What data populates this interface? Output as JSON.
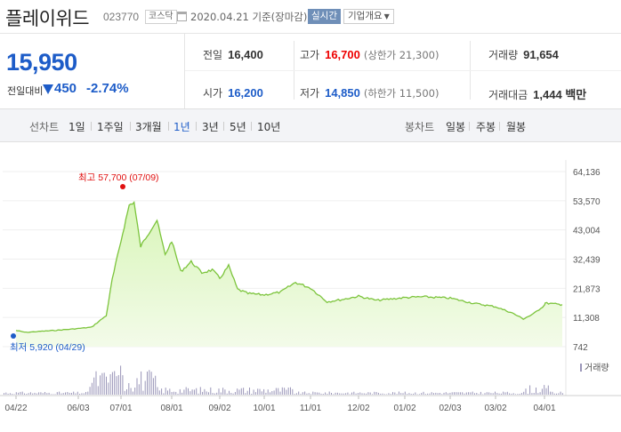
{
  "header": {
    "title": "플레이위드",
    "code": "023770",
    "market": "코스닥",
    "date_text": "2020.04.21 기준(장마감)",
    "realtime_label": "실시간",
    "company_info_label": "기업개요"
  },
  "summary": {
    "price": "15,950",
    "change_label": "전일대비",
    "change_value": "450",
    "change_pct": "-2.74%"
  },
  "stats": {
    "prev_label": "전일",
    "prev_value": "16,400",
    "high_label": "고가",
    "high_value": "16,700",
    "high_limit": "(상한가 21,300)",
    "volume_label": "거래량",
    "volume_value": "91,654",
    "open_label": "시가",
    "open_value": "16,200",
    "low_label": "저가",
    "low_value": "14,850",
    "low_limit": "(하한가 11,500)",
    "amount_label": "거래대금",
    "amount_value": "1,444 백만"
  },
  "periods": {
    "line_label": "선차트",
    "items": [
      "1일",
      "1주일",
      "3개월",
      "1년",
      "3년",
      "5년",
      "10년"
    ],
    "selected": "1년",
    "candle_label": "봉차트",
    "candle_items": [
      "일봉",
      "주봉",
      "월봉"
    ]
  },
  "chart_data": {
    "type": "area",
    "y_ticks": [
      "64,136",
      "53,570",
      "43,004",
      "32,439",
      "21,873",
      "11,308",
      "742"
    ],
    "ylim": [
      742,
      64136
    ],
    "x_ticks": [
      "04/22",
      "06/03",
      "07/01",
      "08/01",
      "09/02",
      "10/01",
      "11/01",
      "12/02",
      "01/02",
      "02/03",
      "03/02",
      "04/01"
    ],
    "high_annotation": "최고 57,700 (07/09)",
    "low_annotation": "최저 5,920 (04/29)",
    "volume_label": "거래량",
    "colors": {
      "line": "#7cc43c",
      "fill_top": "#d8f5b8",
      "fill_bottom": "#f3fbe9",
      "high": "#e01010",
      "low": "#1d5cc8",
      "volume": "#9a96b8"
    },
    "series": [
      {
        "date": "04/22",
        "value": 6600
      },
      {
        "date": "04/29",
        "value": 5920
      },
      {
        "date": "05/08",
        "value": 6300
      },
      {
        "date": "05/20",
        "value": 6700
      },
      {
        "date": "06/03",
        "value": 7300
      },
      {
        "date": "06/12",
        "value": 7800
      },
      {
        "date": "06/22",
        "value": 12000
      },
      {
        "date": "06/26",
        "value": 25000
      },
      {
        "date": "07/01",
        "value": 39000
      },
      {
        "date": "07/06",
        "value": 52000
      },
      {
        "date": "07/09",
        "value": 53000
      },
      {
        "date": "07/13",
        "value": 37000
      },
      {
        "date": "07/17",
        "value": 41000
      },
      {
        "date": "07/23",
        "value": 46500
      },
      {
        "date": "07/28",
        "value": 34000
      },
      {
        "date": "08/01",
        "value": 39000
      },
      {
        "date": "08/07",
        "value": 28000
      },
      {
        "date": "08/14",
        "value": 31500
      },
      {
        "date": "08/21",
        "value": 27500
      },
      {
        "date": "08/28",
        "value": 28500
      },
      {
        "date": "09/02",
        "value": 25500
      },
      {
        "date": "09/08",
        "value": 30000
      },
      {
        "date": "09/14",
        "value": 21500
      },
      {
        "date": "09/21",
        "value": 20000
      },
      {
        "date": "10/01",
        "value": 19500
      },
      {
        "date": "10/12",
        "value": 20500
      },
      {
        "date": "10/22",
        "value": 24000
      },
      {
        "date": "11/01",
        "value": 22000
      },
      {
        "date": "11/12",
        "value": 17000
      },
      {
        "date": "11/22",
        "value": 17800
      },
      {
        "date": "12/02",
        "value": 19000
      },
      {
        "date": "12/14",
        "value": 17500
      },
      {
        "date": "01/02",
        "value": 18500
      },
      {
        "date": "01/15",
        "value": 18800
      },
      {
        "date": "02/03",
        "value": 18300
      },
      {
        "date": "02/18",
        "value": 16500
      },
      {
        "date": "03/02",
        "value": 15200
      },
      {
        "date": "03/12",
        "value": 13000
      },
      {
        "date": "03/19",
        "value": 10800
      },
      {
        "date": "03/25",
        "value": 12500
      },
      {
        "date": "04/01",
        "value": 15800
      },
      {
        "date": "04/14",
        "value": 16500
      },
      {
        "date": "04/21",
        "value": 15950
      }
    ]
  }
}
